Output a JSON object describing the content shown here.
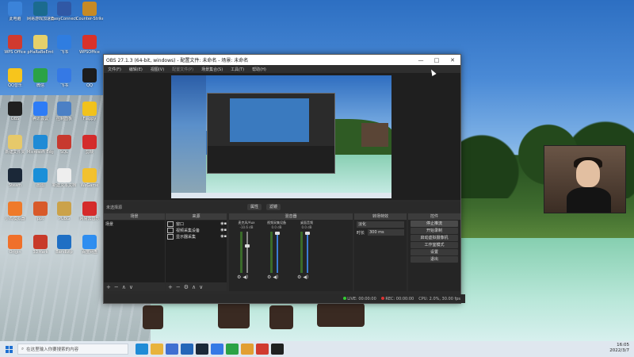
{
  "desktop": {
    "icons": [
      {
        "label": "此电脑",
        "color": "#3b83d9"
      },
      {
        "label": "网易游戏加速器",
        "color": "#1b6b8f"
      },
      {
        "label": "EasyConnect",
        "color": "#3058a5"
      },
      {
        "label": "Counter-Strike",
        "color": "#c78a25"
      },
      {
        "label": "WPS Office",
        "color": "#d03a2f"
      },
      {
        "label": "pHaRaBeEmt",
        "color": "#e5d06a"
      },
      {
        "label": "飞书",
        "color": "#2f7de0"
      },
      {
        "label": "WPSOffice",
        "color": "#d9322a"
      },
      {
        "label": "QQ音乐",
        "color": "#f7c51c"
      },
      {
        "label": "微信",
        "color": "#2ba245"
      },
      {
        "label": "飞书",
        "color": "#3579e5"
      },
      {
        "label": "QQ",
        "color": "#1d1d1d"
      },
      {
        "label": "OBS",
        "color": "#202020"
      },
      {
        "label": "腾讯会议",
        "color": "#2e7cf6"
      },
      {
        "label": "控制面板",
        "color": "#4c80c5"
      },
      {
        "label": "Flappy",
        "color": "#f1c21b"
      },
      {
        "label": "新建文件夹",
        "color": "#e6c96a"
      },
      {
        "label": "Microsoft Edge",
        "color": "#1f8bd6"
      },
      {
        "label": "SQL",
        "color": "#c7392f"
      },
      {
        "label": "剪映",
        "color": "#d42c2c"
      },
      {
        "label": "Steam",
        "color": "#1b2838"
      },
      {
        "label": "画图",
        "color": "#1a8fd8"
      },
      {
        "label": "新建文本文档",
        "color": "#eeeeee"
      },
      {
        "label": "WeGame",
        "color": "#f2c12e"
      },
      {
        "label": "小鸡模拟器",
        "color": "#ef7a2a"
      },
      {
        "label": "ppt",
        "color": "#d85a2a"
      },
      {
        "label": "PUBG",
        "color": "#cba24a"
      },
      {
        "label": "网易云音乐",
        "color": "#d52b2b"
      },
      {
        "label": "Origin",
        "color": "#f0702a"
      },
      {
        "label": "3DMark",
        "color": "#c83a2a"
      },
      {
        "label": "Bandizip",
        "color": "#1f6fc4"
      },
      {
        "label": "百度网盘",
        "color": "#2f8ef0"
      }
    ]
  },
  "obs": {
    "title": "OBS 27.1.3 (64-bit, windows) - 配置文件: 未命名 - 场景: 未命名",
    "window_buttons": [
      "—",
      "□",
      "✕"
    ],
    "menu": [
      "文件(F)",
      "编辑(E)",
      "视图(V)",
      "配置文件(P)",
      "场景集合(S)",
      "工具(T)",
      "帮助(H)"
    ],
    "status_row": {
      "source_label": "未选择源",
      "props_label": "属性",
      "filters_label": "滤镜"
    },
    "docks": {
      "scenes": {
        "title": "场景",
        "items": [
          "场景"
        ]
      },
      "sources": {
        "title": "来源",
        "items": [
          "窗口",
          "视频采集设备",
          "显示器采集"
        ]
      },
      "mixer": {
        "title": "混音器",
        "channels": [
          {
            "name": "麦克风/Aux",
            "db": "-10.6 dB"
          },
          {
            "name": "视频采集设备",
            "db": "0.0 dB"
          },
          {
            "name": "桌面音频",
            "db": "0.0 dB"
          }
        ]
      },
      "transitions": {
        "title": "转场特效",
        "type": "淡化",
        "duration_label": "时长",
        "duration": "300 ms"
      },
      "controls": {
        "title": "控件",
        "buttons": [
          "停止推流",
          "开始录制",
          "启动虚拟摄像机",
          "工作室模式",
          "设置",
          "退出"
        ]
      }
    },
    "bottom": {
      "live": "LIVE: 00:00:00",
      "rec": "REC: 00:00:00",
      "cpu": "CPU: 2.0%, 30.00 fps"
    }
  },
  "taskbar": {
    "search_placeholder": "在这里输入你要搜索的内容",
    "apps": [
      {
        "name": "edge",
        "color": "#1f8bd6"
      },
      {
        "name": "explorer",
        "color": "#e8b33c"
      },
      {
        "name": "store",
        "color": "#3f6fd1"
      },
      {
        "name": "mail",
        "color": "#2466b8"
      },
      {
        "name": "steam",
        "color": "#1b2838"
      },
      {
        "name": "feishu",
        "color": "#3579e5"
      },
      {
        "name": "wechat",
        "color": "#2ba245"
      },
      {
        "name": "files",
        "color": "#e29f32"
      },
      {
        "name": "wps",
        "color": "#d03a2f"
      },
      {
        "name": "obs",
        "color": "#202020"
      }
    ],
    "time": "16:05",
    "date": "2022/3/7"
  }
}
